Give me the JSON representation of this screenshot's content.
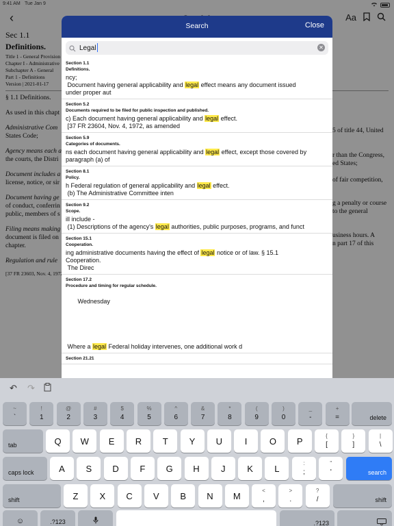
{
  "status": {
    "time": "9:41 AM",
    "date": "Tue Jan 9"
  },
  "document": {
    "title": "Sec 1.1",
    "section": "Sec 1.1",
    "heading": "Definitions.",
    "hierarchy": [
      "Title 1 - General Provision",
      "Chapter I - Administrative",
      "Subchapter A - General",
      "Part 1 - Definitions"
    ],
    "version": "Version | 2021-01-17",
    "section_label": "§ 1.1 Definitions.",
    "paras": [
      "As used in this chapt",
      "Administrative Com",
      "States Code;",
      "Agency means each a",
      "the courts, the Distri",
      "Document includes a",
      "license, notice, or sir",
      "Document having ge",
      "of conduct, conferrin",
      "public, members of s",
      "Filing means making",
      "document is filed on",
      "chapter.",
      "Regulation and rule",
      "[37 FR 23603, Nov. 4, 1972"
    ],
    "right_fragments": [
      "5 of title 44, United",
      "r than the Congress,",
      "ed States;",
      "of fair competition,",
      "g a penalty or course",
      "to the general",
      "usiness hours. A",
      "n part 17 of this"
    ]
  },
  "search": {
    "title": "Search",
    "close_label": "Close",
    "query": "Legal",
    "results": [
      {
        "section": "Section 1.1",
        "title": "Definitions.",
        "before": "ncy;\n Document having general applicability and ",
        "hit": "legal",
        "after": " effect means any document issued\nunder proper aut"
      },
      {
        "section": "Section 5.2",
        "title": "Documents required to be filed for public inspection and published.",
        "before": "c) Each document having general applicability and ",
        "hit": "legal",
        "after": " effect.\n [37 FR 23604, Nov. 4, 1972, as amended"
      },
      {
        "section": "Section 5.9",
        "title": "Categories of documents.",
        "before": "ns each document having general applicability and ",
        "hit": "legal",
        "after": " effect, except those covered by\nparagraph (a) of"
      },
      {
        "section": "Section 8.1",
        "title": "Policy.",
        "before": "h Federal regulation of general applicability and ",
        "hit": "legal",
        "after": " effect.\n (b) The Administrative Committee inten"
      },
      {
        "section": "Section 9.2",
        "title": "Scope.",
        "before": "ill include -\n (1) Descriptions of the agency's ",
        "hit": "legal",
        "after": " authorities, public purposes, programs, and funct"
      },
      {
        "section": "Section 15.1",
        "title": "Cooperation.",
        "before": "ing administrative documents having the effect of ",
        "hit": "legal",
        "after": " notice or of law. § 15.1\nCooperation.\n The Direc"
      },
      {
        "section": "Section 17.2",
        "title": "Procedure and timing for regular schedule.",
        "before": "\n       Wednesday\n\n\n\n\n\n Where a ",
        "hit": "legal",
        "after": " Federal holiday intervenes, one additional work d"
      },
      {
        "section": "Section 21.21",
        "title": "",
        "before": "",
        "hit": "",
        "after": ""
      }
    ]
  },
  "keyboard": {
    "row1": [
      {
        "top": "~",
        "bot": "`"
      },
      {
        "top": "!",
        "bot": "1"
      },
      {
        "top": "@",
        "bot": "2"
      },
      {
        "top": "#",
        "bot": "3"
      },
      {
        "top": "$",
        "bot": "4"
      },
      {
        "top": "%",
        "bot": "5"
      },
      {
        "top": "^",
        "bot": "6"
      },
      {
        "top": "&",
        "bot": "7"
      },
      {
        "top": "*",
        "bot": "8"
      },
      {
        "top": "(",
        "bot": "9"
      },
      {
        "top": ")",
        "bot": "0"
      },
      {
        "top": "_",
        "bot": "-"
      },
      {
        "top": "+",
        "bot": "="
      }
    ],
    "delete": "delete",
    "tab": "tab",
    "row2": [
      "Q",
      "W",
      "E",
      "R",
      "T",
      "Y",
      "U",
      "I",
      "O",
      "P"
    ],
    "row2_punct": [
      {
        "top": "{",
        "bot": "["
      },
      {
        "top": "}",
        "bot": "]"
      },
      {
        "top": "|",
        "bot": "\\"
      }
    ],
    "caps": "caps lock",
    "row3": [
      "A",
      "S",
      "D",
      "F",
      "G",
      "H",
      "J",
      "K",
      "L"
    ],
    "row3_punct": [
      {
        "top": ":",
        "bot": ";"
      },
      {
        "top": "\"",
        "bot": "'"
      }
    ],
    "search": "search",
    "shift": "shift",
    "row4": [
      "Z",
      "X",
      "C",
      "V",
      "B",
      "N",
      "M"
    ],
    "row4_punct": [
      {
        "top": "<",
        "bot": ","
      },
      {
        "top": ">",
        "bot": "."
      },
      {
        "top": "?",
        "bot": "/"
      }
    ],
    "numbers": ".?123"
  }
}
